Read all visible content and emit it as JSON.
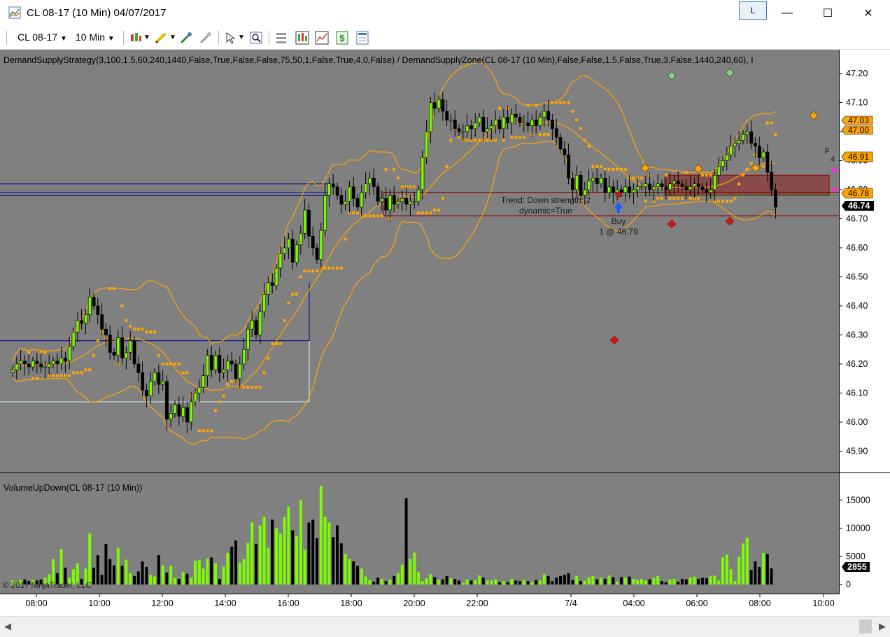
{
  "window": {
    "title": "CL 08-17 (10 Min)  04/07/2017",
    "l_label": "L",
    "minimize_symbol": "—",
    "maximize_symbol": "☐",
    "close_symbol": "✕"
  },
  "toolbar": {
    "instrument": "CL 08-17",
    "interval": "10 Min",
    "icons": [
      "bar-type-icon",
      "drawing-pencil-icon",
      "indicator-icon",
      "strategy-icon",
      "cursor-icon",
      "zoom-icon",
      "properties-icon",
      "chart-style-icon",
      "performance-icon",
      "dollar-icon",
      "data-box-icon"
    ]
  },
  "price_panel": {
    "header": "DemandSupplyStrategy(3,100,1.5,60,240,1440,False,True,False,False,75,50,1,False,True,4,0,False) / DemandSupplyZone(CL 08-17 (10 Min),False,False,1.5,False,True,3,False,1440,240,60), I",
    "price_ticks": [
      "47.20",
      "47.10",
      "47.00",
      "46.90",
      "46.80",
      "46.70",
      "46.60",
      "46.50",
      "46.40",
      "46.30",
      "46.20",
      "46.10",
      "46.00",
      "45.90"
    ],
    "price_labels": [
      {
        "text": "47.03",
        "color": "#ffa500"
      },
      {
        "text": "47.00",
        "color": "#ffa500"
      },
      {
        "text": "46.91",
        "color": "#ffa500"
      },
      {
        "text": "46.78",
        "color": "#ffa500"
      },
      {
        "text": "46.74",
        "color": "#000000"
      }
    ],
    "annotations": {
      "trend_line1": "Trend: Down strength: 2",
      "trend_line2": "dynamic=True",
      "buy_label": "Buy",
      "buy_fill": "1 @ 46.79",
      "stop_partial": "p",
      "stop_partial2": "4"
    }
  },
  "volume_panel": {
    "header": "VolumeUpDown(CL 08-17 (10 Min))",
    "ticks": [
      "15000",
      "10000",
      "5000",
      "0"
    ],
    "last_label": "2855",
    "copyright": "© 2017 NinjaTrader, LLC"
  },
  "time_axis": [
    "08:00",
    "10:00",
    "12:00",
    "14:00",
    "16:00",
    "18:00",
    "20:00",
    "22:00",
    "7/4",
    "04:00",
    "06:00",
    "08:00",
    "10:00"
  ],
  "colors": {
    "background": "#808080",
    "up_candle": "#7cfc00",
    "down_candle": "#000000",
    "bands": "#ffa500",
    "zone_fill": "#8b3a3a",
    "zone_line": "#8b0000",
    "blue_line": "#00008b"
  },
  "chart_data": {
    "type": "candlestick",
    "instrument": "CL 08-17",
    "interval": "10 Min",
    "ylim": [
      45.87,
      47.24
    ],
    "volume_ylim": [
      0,
      18500
    ],
    "closes": [
      46.18,
      46.2,
      46.21,
      46.2,
      46.19,
      46.21,
      46.2,
      46.19,
      46.19,
      46.2,
      46.21,
      46.2,
      46.22,
      46.21,
      46.26,
      46.31,
      46.35,
      46.34,
      46.37,
      46.43,
      46.4,
      46.37,
      46.32,
      46.3,
      46.24,
      46.23,
      46.29,
      46.22,
      46.24,
      46.28,
      46.2,
      46.17,
      46.11,
      46.09,
      46.14,
      46.17,
      46.13,
      46.14,
      46.01,
      46.03,
      46.06,
      46.02,
      46.05,
      46.0,
      46.07,
      46.1,
      46.12,
      46.16,
      46.23,
      46.18,
      46.23,
      46.17,
      46.18,
      46.21,
      46.2,
      46.15,
      46.2,
      46.25,
      46.32,
      46.35,
      46.3,
      46.38,
      46.44,
      46.48,
      46.47,
      46.53,
      46.58,
      46.6,
      46.63,
      46.55,
      46.61,
      46.65,
      46.73,
      46.64,
      46.6,
      46.56,
      46.66,
      46.78,
      46.82,
      46.81,
      46.78,
      46.75,
      46.76,
      46.81,
      46.77,
      46.74,
      46.79,
      46.82,
      46.84,
      46.81,
      46.76,
      46.77,
      46.73,
      46.78,
      46.75,
      46.76,
      46.77,
      46.75,
      46.76,
      46.76,
      46.8,
      46.91,
      47.0,
      47.1,
      47.08,
      47.11,
      47.07,
      47.04,
      47.04,
      47.01,
      47.0,
      47.0,
      47.02,
      47.01,
      47.03,
      47.05,
      47.0,
      47.01,
      47.02,
      47.04,
      47.01,
      47.05,
      47.03,
      47.06,
      47.05,
      47.03,
      47.03,
      47.02,
      47.04,
      47.02,
      47.05,
      47.07,
      47.04,
      47.01,
      46.98,
      46.94,
      46.92,
      46.84,
      46.8,
      46.85,
      46.78,
      46.8,
      46.83,
      46.84,
      46.82,
      46.84,
      46.79,
      46.81,
      46.79,
      46.8,
      46.79,
      46.81,
      46.79,
      46.8,
      46.81,
      46.81,
      46.82,
      46.8,
      46.81,
      46.82,
      46.81,
      46.8,
      46.82,
      46.83,
      46.82,
      46.81,
      46.8,
      46.81,
      46.82,
      46.81,
      46.8,
      46.79,
      46.8,
      46.85,
      46.88,
      46.9,
      46.92,
      46.95,
      46.96,
      46.97,
      46.99,
      47.0,
      46.96,
      46.95,
      46.91,
      46.93,
      46.86,
      46.8,
      46.74
    ],
    "volumes": [
      700,
      500,
      800,
      900,
      600,
      800,
      700,
      900,
      1200,
      1800,
      4500,
      2000,
      6300,
      3000,
      1200,
      2700,
      3800,
      1000,
      2800,
      9000,
      3000,
      5200,
      1700,
      7200,
      4500,
      3400,
      6500,
      3300,
      4400,
      2000,
      1500,
      2300,
      4100,
      3100,
      1700,
      1400,
      5200,
      3400,
      2100,
      3300,
      1200,
      1000,
      2200,
      1900,
      1200,
      4200,
      4400,
      2800,
      4600,
      4800,
      3800,
      1000,
      3200,
      5600,
      6700,
      7800,
      3900,
      4500,
      7400,
      11000,
      7200,
      10500,
      12000,
      6500,
      11500,
      10000,
      9000,
      12000,
      13800,
      9600,
      8600,
      15000,
      6200,
      11000,
      11500,
      8200,
      17500,
      12000,
      11000,
      8400,
      10500,
      7300,
      5400,
      4500,
      4100,
      3300,
      2800,
      1400,
      800,
      500,
      1200,
      1000,
      600,
      900,
      1500,
      2000,
      3500,
      15300,
      4500,
      5700,
      2200,
      600,
      1100,
      1800,
      1300,
      800,
      900,
      1500,
      1100,
      1000,
      700,
      300,
      900,
      700,
      800,
      1600,
      1200,
      700,
      700,
      900,
      400,
      600,
      400,
      1000,
      700,
      600,
      800,
      600,
      500,
      800,
      700,
      1800,
      1500,
      600,
      1200,
      1500,
      1700,
      2000,
      800,
      1500,
      600,
      700,
      1300,
      1500,
      900,
      1200,
      1000,
      1600,
      1300,
      500,
      1300,
      1200,
      1400,
      1000,
      800,
      1000,
      700,
      900,
      1200,
      1500,
      600,
      400,
      900,
      1000,
      500,
      1000,
      900,
      1200,
      1400,
      1000,
      1200,
      1100,
      1500,
      1600,
      700,
      4800,
      5300,
      2700,
      600,
      4900,
      7300,
      8300,
      2600,
      4100,
      3100,
      5600,
      5400,
      2855
    ],
    "support_resistance_lines": [
      46.82,
      46.79,
      46.78,
      46.28,
      46.07
    ],
    "demand_zone": {
      "top": 46.85,
      "bottom": 46.78
    },
    "supply_line": {
      "top": 46.79,
      "bottom": 46.71
    },
    "trade": {
      "side": "Buy",
      "qty": 1,
      "price": 46.79
    },
    "trend": {
      "direction": "Down",
      "strength": 2,
      "dynamic": true
    }
  }
}
